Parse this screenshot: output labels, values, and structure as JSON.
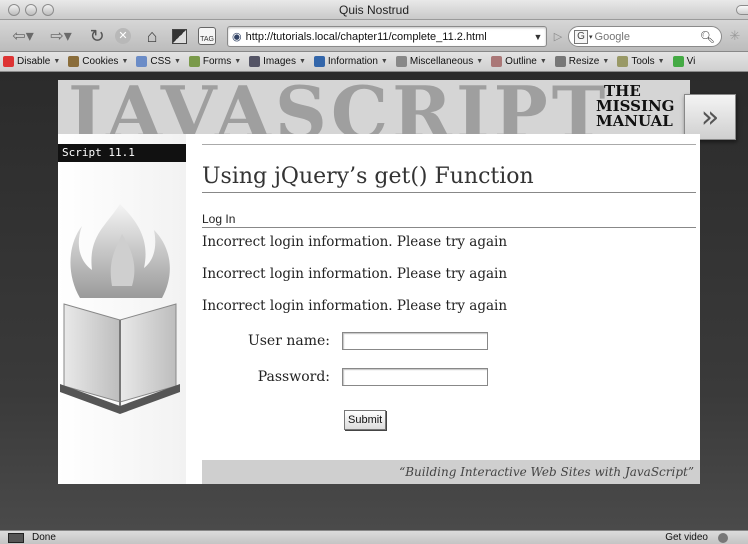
{
  "window": {
    "title": "Quis Nostrud"
  },
  "navbar": {
    "url": "http://tutorials.local/chapter11/complete_11.2.html",
    "search_engine": "Google",
    "search_placeholder": "Google",
    "icons": [
      "back-icon",
      "forward-icon",
      "reload-icon",
      "stop-icon",
      "home-icon",
      "bookmark-icon",
      "tag-icon",
      "search-icon"
    ]
  },
  "devbar": {
    "items": [
      {
        "label": "Disable",
        "icon": "disable-icon",
        "color": "#d33"
      },
      {
        "label": "Cookies",
        "icon": "cookies-icon",
        "color": "#8a6d3b"
      },
      {
        "label": "CSS",
        "icon": "css-icon",
        "color": "#6b8cc7"
      },
      {
        "label": "Forms",
        "icon": "forms-icon",
        "color": "#7a9a4a"
      },
      {
        "label": "Images",
        "icon": "images-icon",
        "color": "#556"
      },
      {
        "label": "Information",
        "icon": "info-icon",
        "color": "#36a"
      },
      {
        "label": "Miscellaneous",
        "icon": "misc-icon",
        "color": "#888"
      },
      {
        "label": "Outline",
        "icon": "outline-icon",
        "color": "#a77"
      },
      {
        "label": "Resize",
        "icon": "resize-icon",
        "color": "#777"
      },
      {
        "label": "Tools",
        "icon": "tools-icon",
        "color": "#996"
      },
      {
        "label": "Vi",
        "icon": "view-source-icon",
        "color": "#4a4"
      }
    ]
  },
  "banner": {
    "word": "JAVASCRIPT",
    "badge_line1": "THE",
    "badge_line2": "MISSING",
    "badge_line3": "MANUAL",
    "arrow": "»"
  },
  "page": {
    "script_label": "Script 11.1",
    "heading": "Using jQuery’s get() Function",
    "subheading": "Log In",
    "errors": [
      "Incorrect login information. Please try again",
      "Incorrect login information. Please try again",
      "Incorrect login information. Please try again"
    ],
    "username_label": "User name:",
    "password_label": "Password:",
    "username_value": "",
    "password_value": "",
    "submit_label": "Submit",
    "footer": "“Building Interactive Web Sites with JavaScript”"
  },
  "statusbar": {
    "status": "Done",
    "get_video": "Get video"
  }
}
